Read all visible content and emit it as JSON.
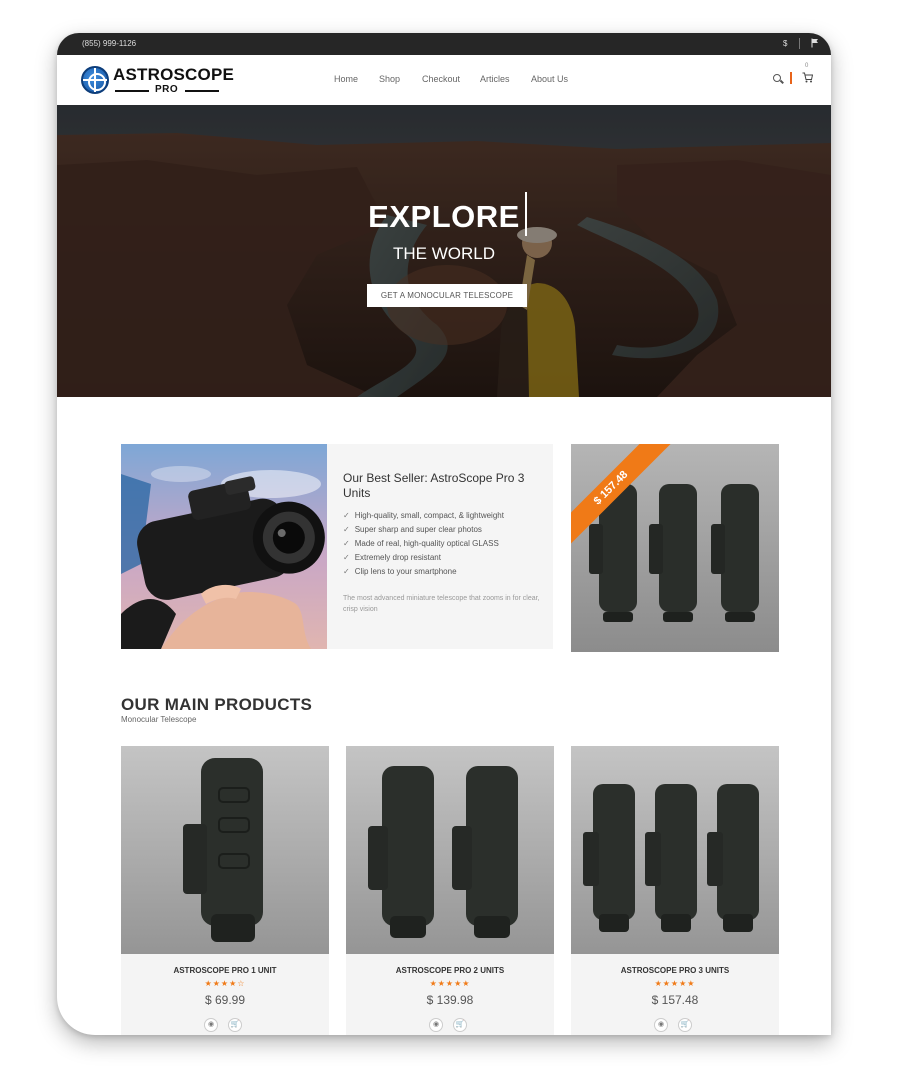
{
  "topbar": {
    "phone": "(855) 999-1126",
    "currency": "$",
    "flag_icon": "flag-icon"
  },
  "brand": {
    "name": "ASTROSCOPE",
    "sub": "PRO"
  },
  "nav": {
    "items": [
      "Home",
      "Shop",
      "Checkout",
      "Articles",
      "About Us"
    ]
  },
  "header_icons": {
    "search": "search-icon",
    "cart": "cart-icon",
    "cart_count": "0"
  },
  "hero": {
    "title": "EXPLORE",
    "subtitle": "THE WORLD",
    "cta": "GET A MONOCULAR TELESCOPE"
  },
  "best_seller": {
    "title": "Our Best Seller: AstroScope Pro 3 Units",
    "features": [
      "High-quality, small, compact, & lightweight",
      "Super sharp and super clear photos",
      "Made of real, high-quality optical GLASS",
      "Extremely drop resistant",
      "Clip lens to your smartphone"
    ],
    "description": "The most advanced miniature telescope that zooms in for clear, crisp vision"
  },
  "promo": {
    "price_ribbon": "$ 157.48"
  },
  "products_section": {
    "title": "OUR MAIN PRODUCTS",
    "subtitle": "Monocular Telescope"
  },
  "products": [
    {
      "name": "ASTROSCOPE PRO 1 UNIT",
      "stars": "★★★★☆",
      "rating": 4,
      "price": "$ 69.99"
    },
    {
      "name": "ASTROSCOPE PRO 2 UNITS",
      "stars": "★★★★★",
      "rating": 5,
      "price": "$ 139.98"
    },
    {
      "name": "ASTROSCOPE PRO 3 UNITS",
      "stars": "★★★★★",
      "rating": 5,
      "price": "$ 157.48"
    }
  ],
  "colors": {
    "accent": "#f07a17",
    "topbar": "#262626",
    "brand_blue": "#1a5fb4"
  }
}
